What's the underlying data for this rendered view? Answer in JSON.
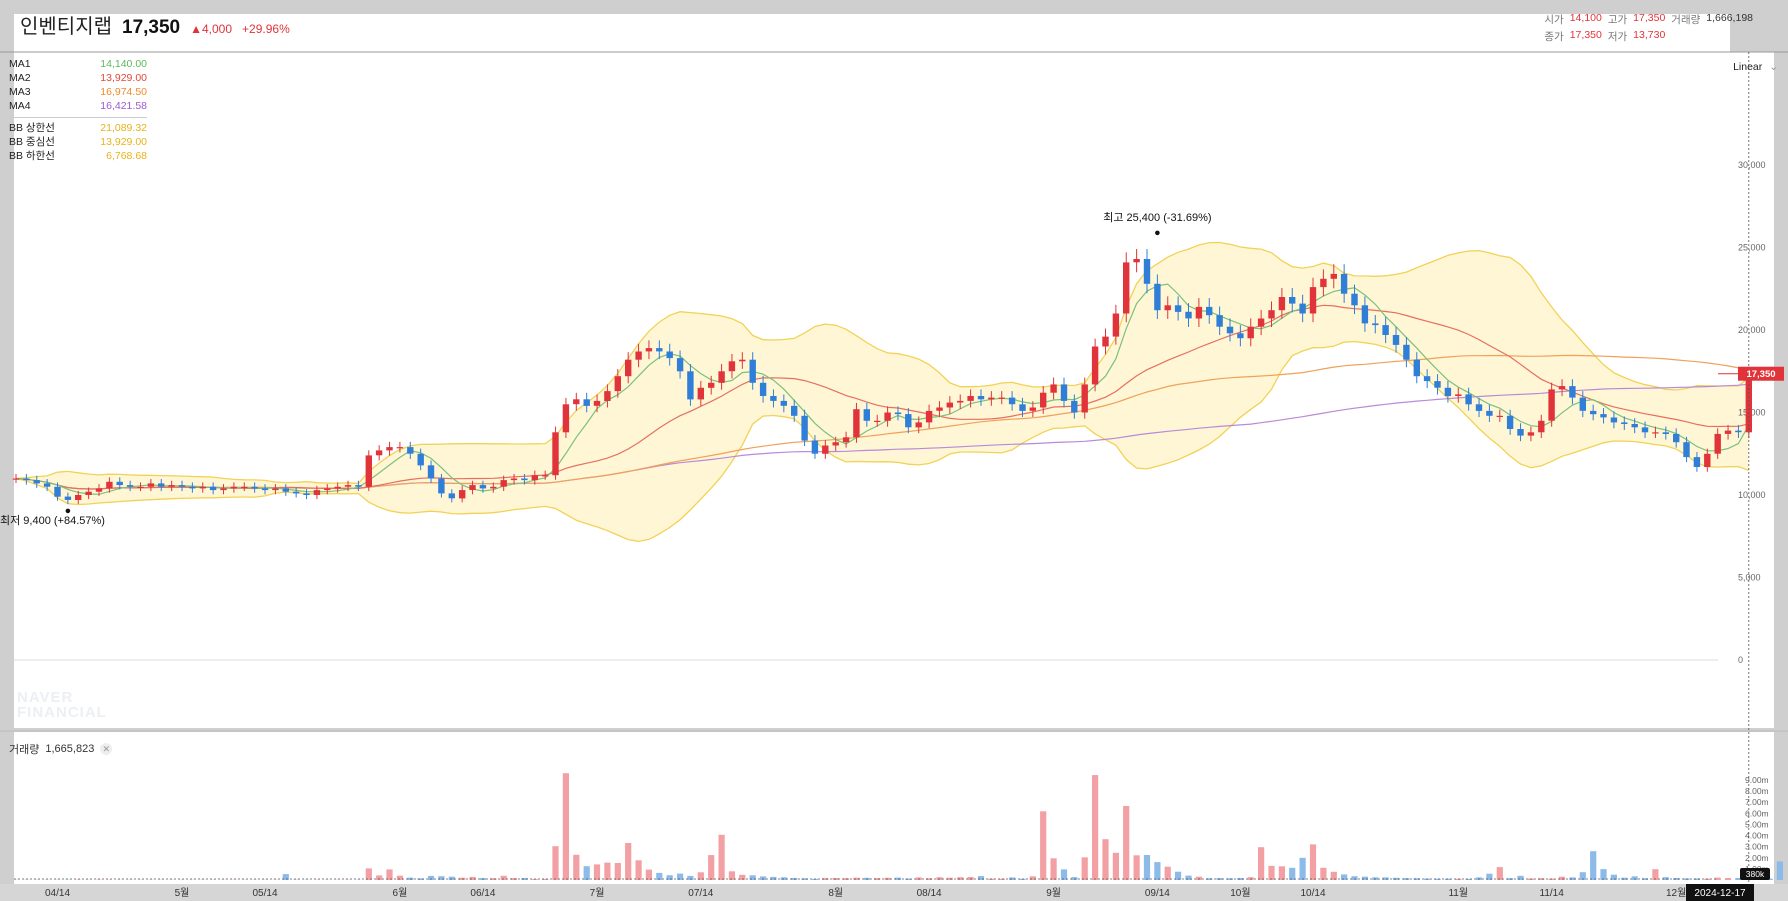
{
  "stock": {
    "name": "인벤티지랩",
    "price": "17,350",
    "change": "▲4,000",
    "change_pct": "+29.96%"
  },
  "ohlc": {
    "open_label": "시가",
    "open": "14,100",
    "high_label": "고가",
    "high": "17,350",
    "volume_label": "거래량",
    "volume": "1,666,198",
    "close_label": "종가",
    "close": "17,350",
    "low_label": "저가",
    "low": "13,730"
  },
  "legend": {
    "ma": [
      {
        "label": "MA1",
        "value": "14,140.00",
        "color": "#5cb85c"
      },
      {
        "label": "MA2",
        "value": "13,929.00",
        "color": "#e2483b"
      },
      {
        "label": "MA3",
        "value": "16,974.50",
        "color": "#f08a2c"
      },
      {
        "label": "MA4",
        "value": "16,421.58",
        "color": "#9b59d0"
      }
    ],
    "bb": [
      {
        "label": "BB 상한선",
        "value": "21,089.32",
        "color": "#e8b21c"
      },
      {
        "label": "BB 중심선",
        "value": "13,929.00",
        "color": "#e8b21c"
      },
      {
        "label": "BB 하한선",
        "value": "6,768.68",
        "color": "#e8b21c"
      }
    ]
  },
  "scale_mode": "Linear",
  "watermark": [
    "NAVER",
    "FINANCIAL"
  ],
  "volume_panel": {
    "label": "거래량",
    "value": "1,665,823"
  },
  "colors": {
    "up": "#e0343a",
    "down": "#2f7ed8",
    "vol_up": "#f2a0a3",
    "vol_down": "#8cbbe9",
    "band_fill": "#fff6d6",
    "band_line": "#f2d255"
  },
  "chart_data": {
    "type": "candlestick",
    "y_ticks": [
      "30,000",
      "25,000",
      "20,000",
      "15,000",
      "10,000",
      "5,000",
      "0"
    ],
    "ylim": [
      -2500,
      33500
    ],
    "x_ticks": [
      {
        "label": "04/14",
        "idx": 4
      },
      {
        "label": "5월",
        "idx": 16
      },
      {
        "label": "05/14",
        "idx": 24
      },
      {
        "label": "6월",
        "idx": 37
      },
      {
        "label": "06/14",
        "idx": 45
      },
      {
        "label": "7월",
        "idx": 56
      },
      {
        "label": "07/14",
        "idx": 66
      },
      {
        "label": "8월",
        "idx": 79
      },
      {
        "label": "08/14",
        "idx": 88
      },
      {
        "label": "9월",
        "idx": 100
      },
      {
        "label": "09/14",
        "idx": 110
      },
      {
        "label": "10월",
        "idx": 118
      },
      {
        "label": "10/14",
        "idx": 125
      },
      {
        "label": "11월",
        "idx": 139
      },
      {
        "label": "11/14",
        "idx": 148
      },
      {
        "label": "12월",
        "idx": 160
      }
    ],
    "current_price_label": "17,350",
    "current_date_label": "2024-12-17",
    "volume_ticks": [
      "9.00m",
      "8.00m",
      "7.00m",
      "6.00m",
      "5.00m",
      "4.00m",
      "3.00m",
      "2.00m",
      "1.00m"
    ],
    "volume_axis_label": "380k",
    "annotations": [
      {
        "text": "최고 25,400 (-31.69%)",
        "idx": 110,
        "price": 25400
      },
      {
        "text": "최저 9,400 (+84.57%)",
        "idx": 5,
        "price": 9400
      }
    ],
    "closes": [
      11000,
      10900,
      10700,
      10500,
      9900,
      9700,
      10000,
      10200,
      10400,
      10800,
      10600,
      10500,
      10500,
      10700,
      10500,
      10600,
      10500,
      10400,
      10500,
      10300,
      10400,
      10500,
      10500,
      10400,
      10300,
      10400,
      10200,
      10100,
      10000,
      10300,
      10400,
      10500,
      10600,
      10500,
      12400,
      12700,
      12900,
      12900,
      12500,
      11800,
      11000,
      10100,
      9800,
      10300,
      10600,
      10400,
      10500,
      10900,
      11000,
      10900,
      11200,
      11200,
      13800,
      15500,
      15800,
      15400,
      15700,
      16300,
      17200,
      18200,
      18700,
      18900,
      18700,
      18300,
      17500,
      15800,
      16500,
      16800,
      17500,
      18100,
      18200,
      16800,
      16000,
      15700,
      15400,
      14800,
      13300,
      12500,
      13000,
      13200,
      13500,
      15200,
      14500,
      14500,
      15000,
      14900,
      14100,
      14400,
      15100,
      15300,
      15600,
      15700,
      16000,
      15800,
      15900,
      15900,
      15500,
      15100,
      15300,
      16200,
      16700,
      15700,
      15000,
      16700,
      19000,
      19600,
      21000,
      24100,
      24300,
      22800,
      21200,
      21500,
      21100,
      20700,
      21400,
      20900,
      20200,
      19800,
      19500,
      20200,
      20700,
      21200,
      22000,
      21600,
      21000,
      22600,
      23100,
      23400,
      22200,
      21500,
      20400,
      20300,
      19700,
      19100,
      18200,
      17200,
      16900,
      16500,
      16000,
      16100,
      15500,
      15100,
      14800,
      14800,
      14000,
      13600,
      13800,
      14500,
      16400,
      16600,
      15900,
      15100,
      14900,
      14700,
      14400,
      14300,
      14100,
      13800,
      13800,
      13700,
      13200,
      12300,
      11700,
      12500,
      13700,
      13900,
      13800,
      17350
    ],
    "volumes_m": [
      0.02,
      0.02,
      0.02,
      0.02,
      0.02,
      0.02,
      0.03,
      0.02,
      0.03,
      0.02,
      0.02,
      0.02,
      0.02,
      0.02,
      0.02,
      0.02,
      0.02,
      0.02,
      0.02,
      0.02,
      0.02,
      0.02,
      0.02,
      0.02,
      0.02,
      0.02,
      0.53,
      0.03,
      0.02,
      0.02,
      0.02,
      0.02,
      0.02,
      0.02,
      1.04,
      0.41,
      0.95,
      0.39,
      0.22,
      0.14,
      0.37,
      0.34,
      0.3,
      0.21,
      0.28,
      0.17,
      0.16,
      0.38,
      0.17,
      0.18,
      0.08,
      0.1,
      3.04,
      9.61,
      2.27,
      1.24,
      1.4,
      1.57,
      1.53,
      3.33,
      1.77,
      0.94,
      0.64,
      0.43,
      0.58,
      0.37,
      0.69,
      2.24,
      4.07,
      0.78,
      0.47,
      0.42,
      0.32,
      0.28,
      0.24,
      0.18,
      0.15,
      0.1,
      0.17,
      0.18,
      0.16,
      0.21,
      0.2,
      0.17,
      0.2,
      0.22,
      0.13,
      0.23,
      0.16,
      0.25,
      0.21,
      0.25,
      0.27,
      0.35,
      0.12,
      0.12,
      0.23,
      0.11,
      0.33,
      6.18,
      1.95,
      0.95,
      0.26,
      2.04,
      9.44,
      3.67,
      2.45,
      6.66,
      2.22,
      2.25,
      1.61,
      1.2,
      0.75,
      0.4,
      0.3,
      0.16,
      0.17,
      0.15,
      0.18,
      0.25,
      2.95,
      1.27,
      1.23,
      1.1,
      2.0,
      3.2,
      1.1,
      0.74,
      0.5,
      0.34,
      0.3,
      0.24,
      0.23,
      0.2,
      0.17,
      0.16,
      0.13,
      0.12,
      0.12,
      0.11,
      0.1,
      0.23,
      0.57,
      1.16,
      0.16,
      0.38,
      0.13,
      0.16,
      0.12,
      0.3,
      0.23,
      0.7,
      2.59,
      0.98,
      0.48,
      0.21,
      0.33,
      0.16,
      0.97,
      0.25,
      0.18,
      0.14,
      0.14,
      0.12,
      0.22,
      0.18,
      0.18,
      0.14,
      0.16,
      0.13,
      1.67
    ]
  }
}
